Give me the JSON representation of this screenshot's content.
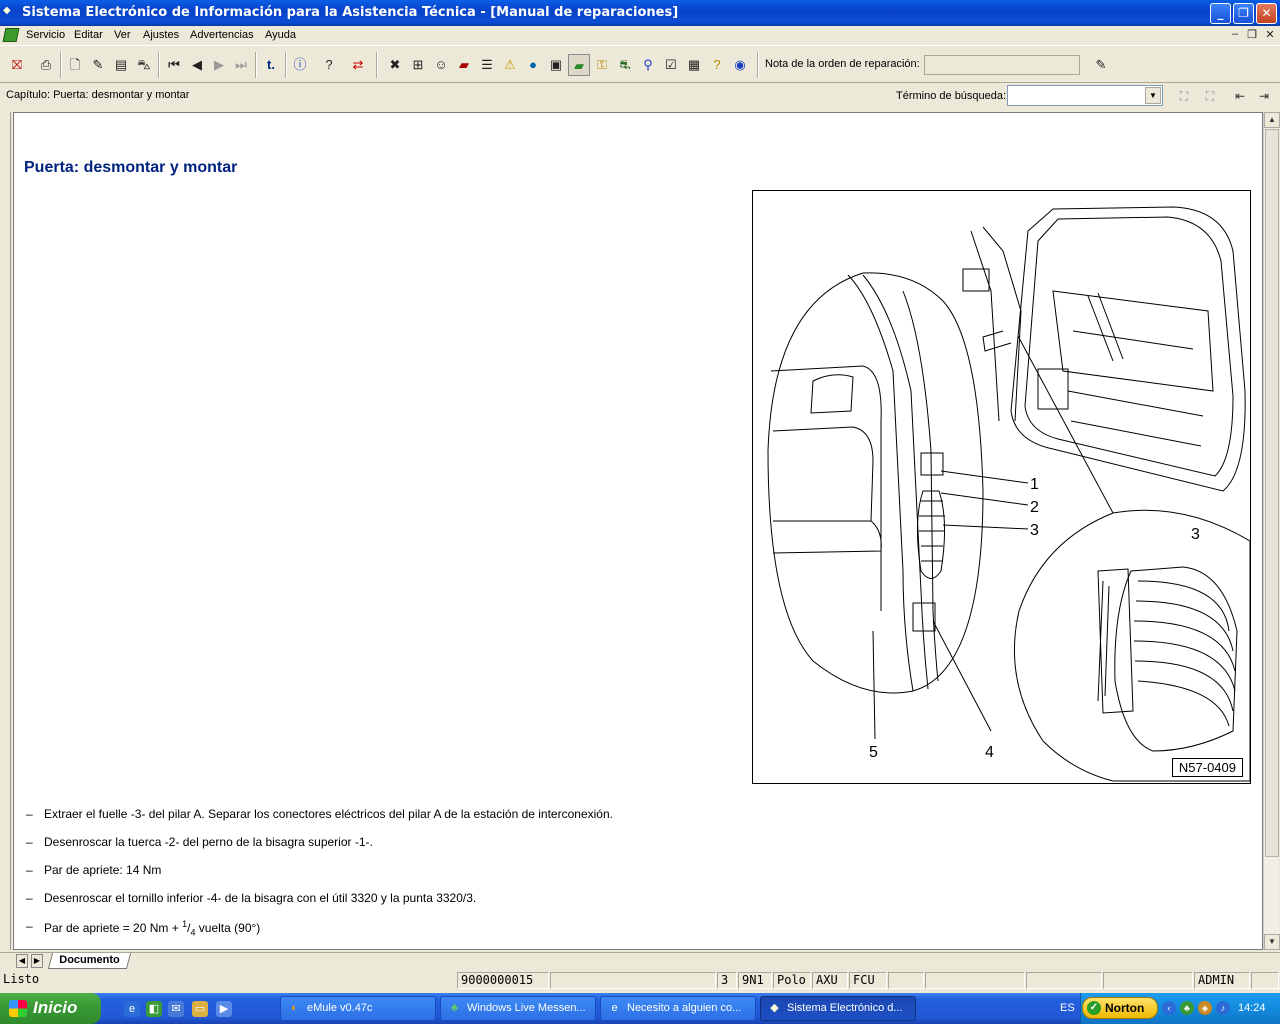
{
  "window": {
    "title": "Sistema Electrónico de Información para la Asistencia Técnica - [Manual de reparaciones]"
  },
  "menu": {
    "items": [
      "Servicio",
      "Editar",
      "Ver",
      "Ajustes",
      "Advertencias",
      "Ayuda"
    ]
  },
  "toolbar": {
    "icons": [
      "exit-icon",
      "print-icon",
      "new-document-icon",
      "edit-document-icon",
      "notes-icon",
      "vehicle-icon",
      "first-page-icon",
      "previous-page-icon",
      "next-page-icon",
      "last-page-icon",
      "text-link-icon",
      "info-icon",
      "help-icon",
      "swap-icon",
      "tools-icon",
      "module-icon",
      "person-icon",
      "book-icon",
      "list-icon",
      "warning-icon",
      "globe-icon",
      "save-icon",
      "active-book-icon",
      "key-icon",
      "car-icon",
      "search-vehicle-icon",
      "checklist-icon",
      "stack-icon",
      "hint-icon",
      "flag-icon"
    ],
    "nota_label": "Nota de la orden de reparación:",
    "nota_value": ""
  },
  "chapter_bar": {
    "chapter": "Capítulo: Puerta: desmontar y montar",
    "search_label": "Término de búsqueda:",
    "search_value": ""
  },
  "document": {
    "title": "Puerta: desmontar y montar",
    "figure": {
      "code": "N57-0409",
      "callouts": [
        "1",
        "2",
        "3",
        "3",
        "4",
        "5"
      ]
    },
    "steps": [
      "Extraer el fuelle -3- del pilar A. Separar los conectores eléctricos del pilar A de la estación de interconexión.",
      "Desenroscar la tuerca -2- del perno de la bisagra superior -1-.",
      "Par de apriete: 14 Nm",
      "Desenroscar el tornillo inferior -4- de la bisagra con el útil 3320 y la punta 3320/3."
    ],
    "last_step": {
      "prefix": "Par de apriete = 20 Nm + ",
      "numerator": "1",
      "slash": "/",
      "denominator": "4",
      "suffix": " vuelta (90°)"
    },
    "bullet": "–"
  },
  "tabs": {
    "active": "Documento"
  },
  "statusbar": {
    "status": "Listo",
    "order_number": "9000000015",
    "field_3": "3",
    "field_9n1": "9N1",
    "field_polo": "Polo",
    "field_axu": "AXU",
    "field_fcu": "FCU",
    "user": "ADMIN"
  },
  "taskbar": {
    "start": "Inicio",
    "tasks": [
      "eMule v0.47c",
      "Windows Live Messen...",
      "Necesito a alguien co...",
      "Sistema Electrónico d..."
    ],
    "language": "ES",
    "norton": "Norton",
    "clock": "14:24"
  }
}
